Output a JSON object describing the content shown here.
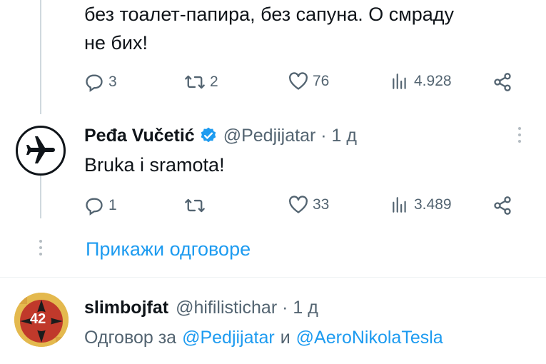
{
  "tweet1": {
    "text_line1": "без тоалет-папира, без сапуна. О смраду",
    "text_line2": "не бих!",
    "replies": "3",
    "retweets": "2",
    "likes": "76",
    "views": "4.928"
  },
  "tweet2": {
    "name": "Peđa Vučetić",
    "handle": "@Pedjijatar · 1 д",
    "text": "Bruka i sramota!",
    "replies": "1",
    "retweets": "",
    "likes": "33",
    "views": "3.489",
    "avatar_icon": "airplane-icon"
  },
  "show_replies": "Прикажи одговоре",
  "tweet3": {
    "name": "slimbojfat",
    "handle": "@hifilistichar · 1 д",
    "reply_prefix": "Одговор за",
    "reply_user1": "@Pedjijatar",
    "reply_and": "и",
    "reply_user2": "@AeroNikolaTesla",
    "avatar_text": "42"
  },
  "colors": {
    "link": "#1d9bf0",
    "verified": "#1d9bf0",
    "muted": "#536471"
  }
}
